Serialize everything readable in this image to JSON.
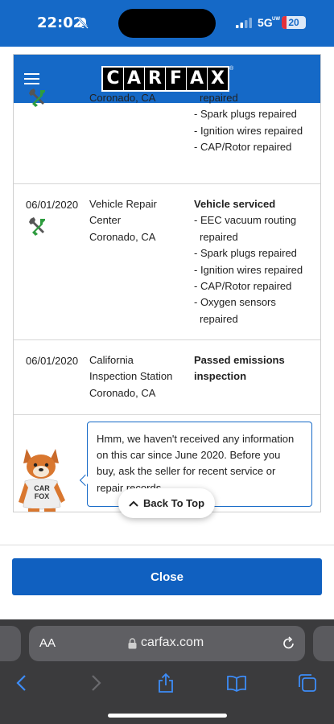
{
  "status_bar": {
    "time": "22:02",
    "network": "5G",
    "network_sub": "UW",
    "battery": "20",
    "battery_level": 0.2
  },
  "header": {
    "logo_letters": [
      "C",
      "A",
      "R",
      "F",
      "A",
      "X"
    ],
    "logo_reg": "®"
  },
  "records": [
    {
      "date": "",
      "location": [
        "Coronado, CA"
      ],
      "title": "",
      "items": [
        [
          "repaired"
        ],
        [
          "- Spark plugs repaired"
        ],
        [
          "- Ignition wires repaired"
        ],
        [
          "- CAP/Rotor repaired"
        ]
      ]
    },
    {
      "date": "06/01/2020",
      "location": [
        "Vehicle Repair",
        "Center",
        "Coronado, CA"
      ],
      "title": "Vehicle serviced",
      "items": [
        [
          "- EEC vacuum routing",
          "repaired"
        ],
        [
          "- Spark plugs repaired"
        ],
        [
          "- Ignition wires repaired"
        ],
        [
          "- CAP/Rotor repaired"
        ],
        [
          "- Oxygen sensors",
          "repaired"
        ]
      ]
    },
    {
      "date": "06/01/2020",
      "location": [
        "California",
        "Inspection Station",
        "Coronado, CA"
      ],
      "title": "Passed emissions inspection",
      "items": []
    }
  ],
  "bubble": {
    "lines": [
      "Hmm, we haven't received any information",
      "on this car since June 2020. Before you",
      "buy, ask the seller for recent service or",
      "repair records."
    ]
  },
  "fox": {
    "shirt_line1": "CAR",
    "shirt_line2": "FOX"
  },
  "back_to_top": "Back To Top",
  "close_label": "Close",
  "safari": {
    "aa": "AA",
    "url": "carfax.com"
  },
  "colors": {
    "brand_blue": "#1569c7",
    "button_blue": "#1060c0",
    "battery_red": "#e0313b"
  }
}
